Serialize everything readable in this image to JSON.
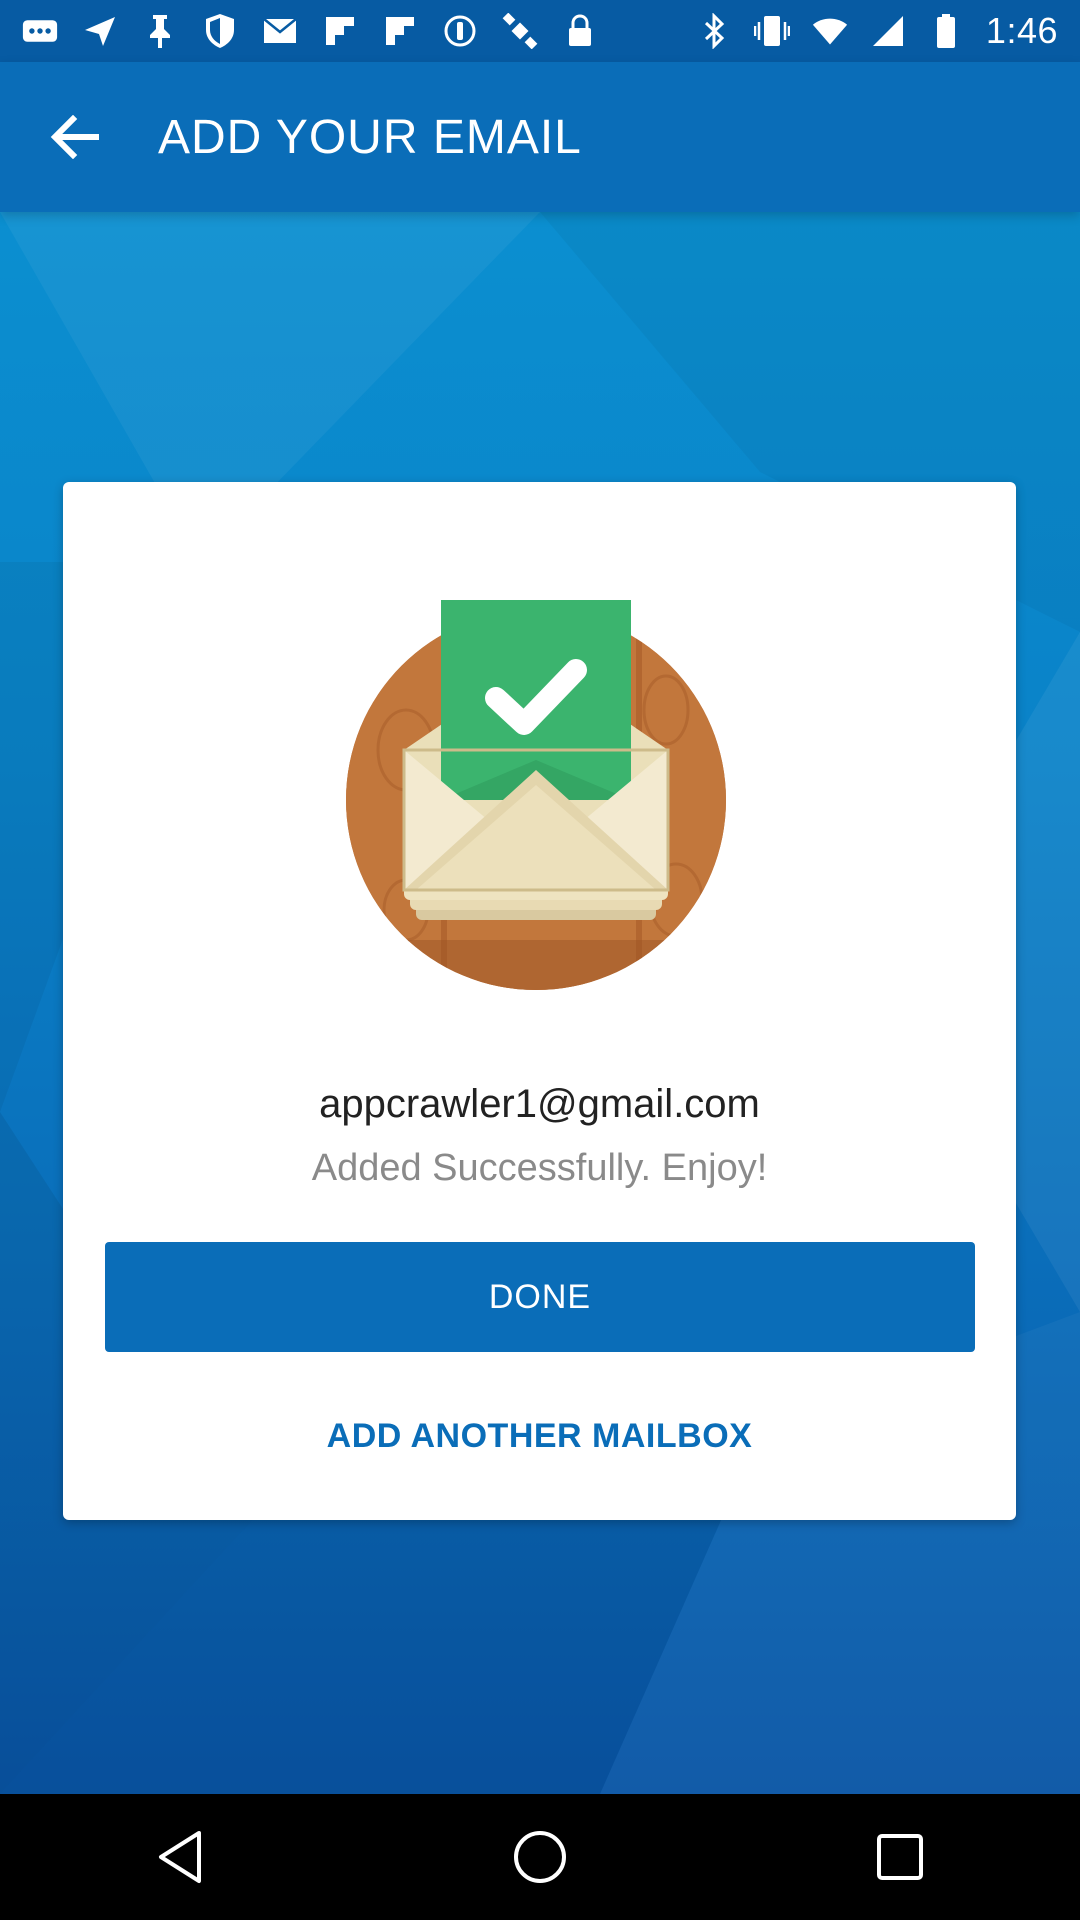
{
  "status_bar": {
    "time": "1:46",
    "left_icons": [
      "more-icon",
      "send-icon",
      "pin-icon",
      "shield-icon",
      "mail-icon",
      "flipboard-icon",
      "flipboard-icon",
      "circle-info-icon",
      "satellite-icon",
      "lock-icon"
    ],
    "right_icons": [
      "bluetooth-icon",
      "vibrate-icon",
      "wifi-icon",
      "signal-icon",
      "battery-icon"
    ]
  },
  "app_bar": {
    "title": "ADD YOUR EMAIL",
    "back_icon": "back-arrow-icon"
  },
  "card": {
    "illustration": "envelope-check-icon",
    "email": "appcrawler1@gmail.com",
    "message": "Added Successfully. Enjoy!",
    "done_label": "DONE",
    "add_another_label": "ADD ANOTHER MAILBOX"
  },
  "nav_bar": {
    "back": "nav-back-icon",
    "home": "nav-home-icon",
    "recents": "nav-recents-icon"
  },
  "colors": {
    "primary": "#0a6db8",
    "status_bar": "#075ba3",
    "background_top": "#0b8fd0",
    "background_bottom": "#0955a5",
    "check_green": "#3bb46e"
  }
}
